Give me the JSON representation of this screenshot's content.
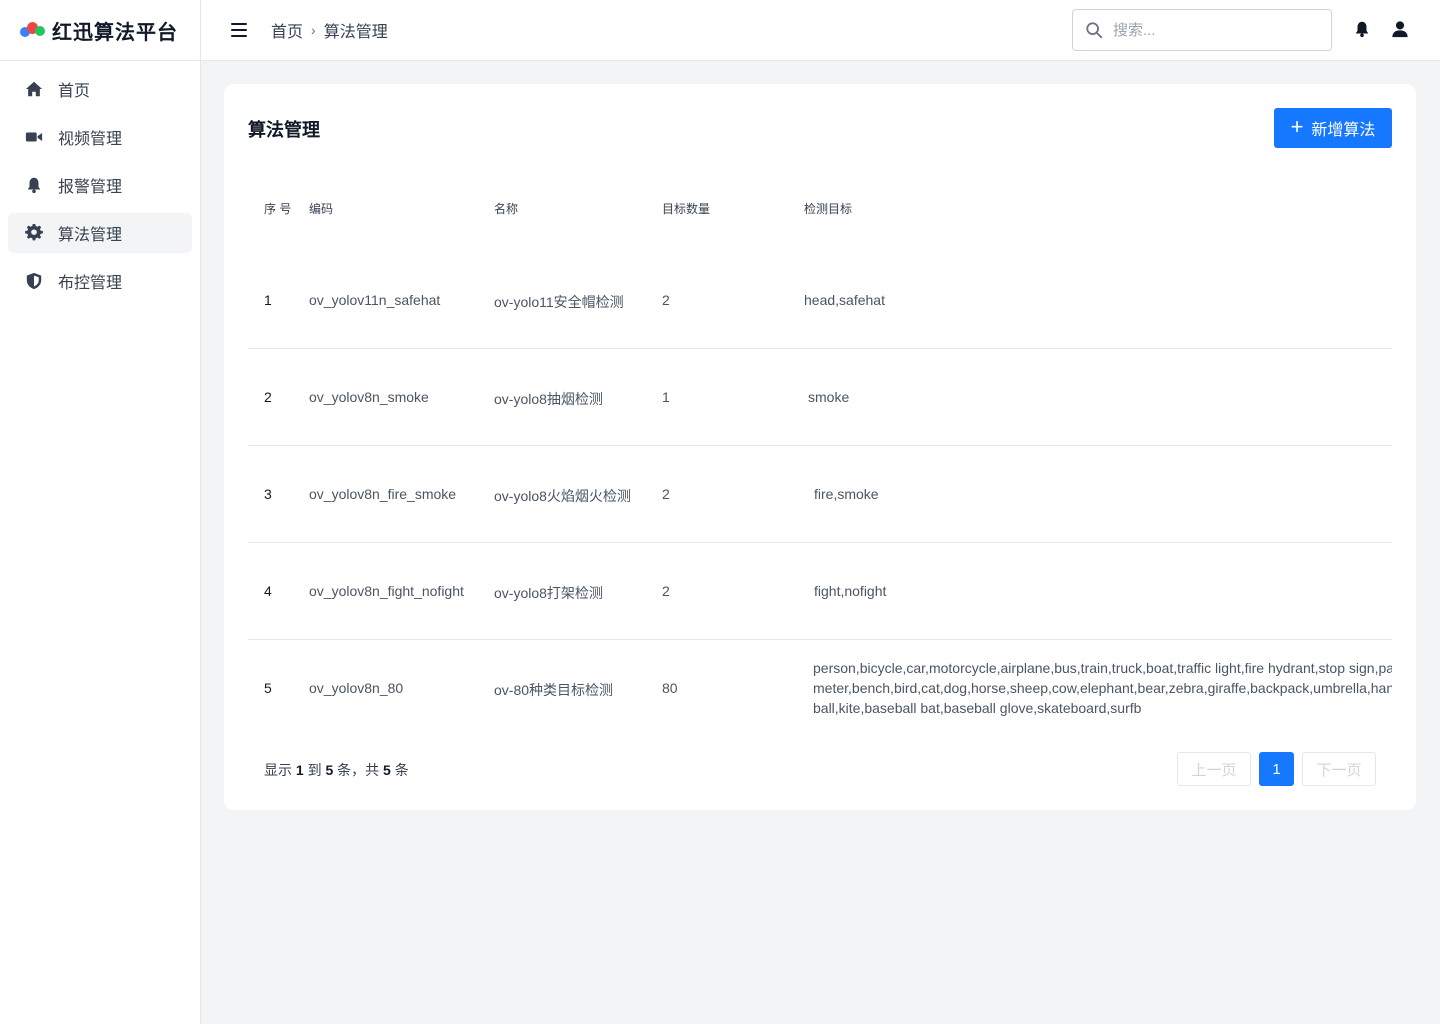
{
  "app": {
    "name": "红迅算法平台"
  },
  "sidebar": {
    "items": [
      {
        "label": "首页",
        "icon": "home-icon"
      },
      {
        "label": "视频管理",
        "icon": "video-icon"
      },
      {
        "label": "报警管理",
        "icon": "bell-icon"
      },
      {
        "label": "算法管理",
        "icon": "gear-icon",
        "active": true
      },
      {
        "label": "布控管理",
        "icon": "shield-icon"
      }
    ]
  },
  "header": {
    "breadcrumb": [
      "首页",
      "算法管理"
    ],
    "search_placeholder": "搜索..."
  },
  "main": {
    "title": "算法管理",
    "add_button": "新增算法",
    "table": {
      "columns": [
        "序 号",
        "编码",
        "名称",
        "目标数量",
        "检测目标"
      ],
      "rows": [
        {
          "index": "1",
          "code": "ov_yolov11n_safehat",
          "name": "ov-yolo11安全帽检测",
          "count": "2",
          "targets": "head,safehat"
        },
        {
          "index": "2",
          "code": "ov_yolov8n_smoke",
          "name": "ov-yolo8抽烟检测",
          "count": "1",
          "targets": "smoke"
        },
        {
          "index": "3",
          "code": "ov_yolov8n_fire_smoke",
          "name": "ov-yolo8火焰烟火检测",
          "count": "2",
          "targets": "fire,smoke"
        },
        {
          "index": "4",
          "code": "ov_yolov8n_fight_nofight",
          "name": "ov-yolo8打架检测",
          "count": "2",
          "targets": "fight,nofight"
        },
        {
          "index": "5",
          "code": "ov_yolov8n_80",
          "name": "ov-80种类目标检测",
          "count": "80",
          "targets_lines": [
            "person,bicycle,car,motorcycle,airplane,bus,train,truck,boat,traffic light,fire hydrant,stop sign,pa",
            "meter,bench,bird,cat,dog,horse,sheep,cow,elephant,bear,zebra,giraffe,backpack,umbrella,handl",
            "ball,kite,baseball bat,baseball glove,skateboard,surfb"
          ]
        }
      ]
    },
    "pagination": {
      "prefix": "显示",
      "from": "1",
      "to_word": "到",
      "to": "5",
      "mid": "条，共",
      "total": "5",
      "suffix": "条",
      "prev": "上一页",
      "current": "1",
      "next": "下一页"
    }
  },
  "colors": {
    "primary": "#1677ff",
    "background": "#f3f4f6",
    "active_nav": "#f3f4f6"
  }
}
